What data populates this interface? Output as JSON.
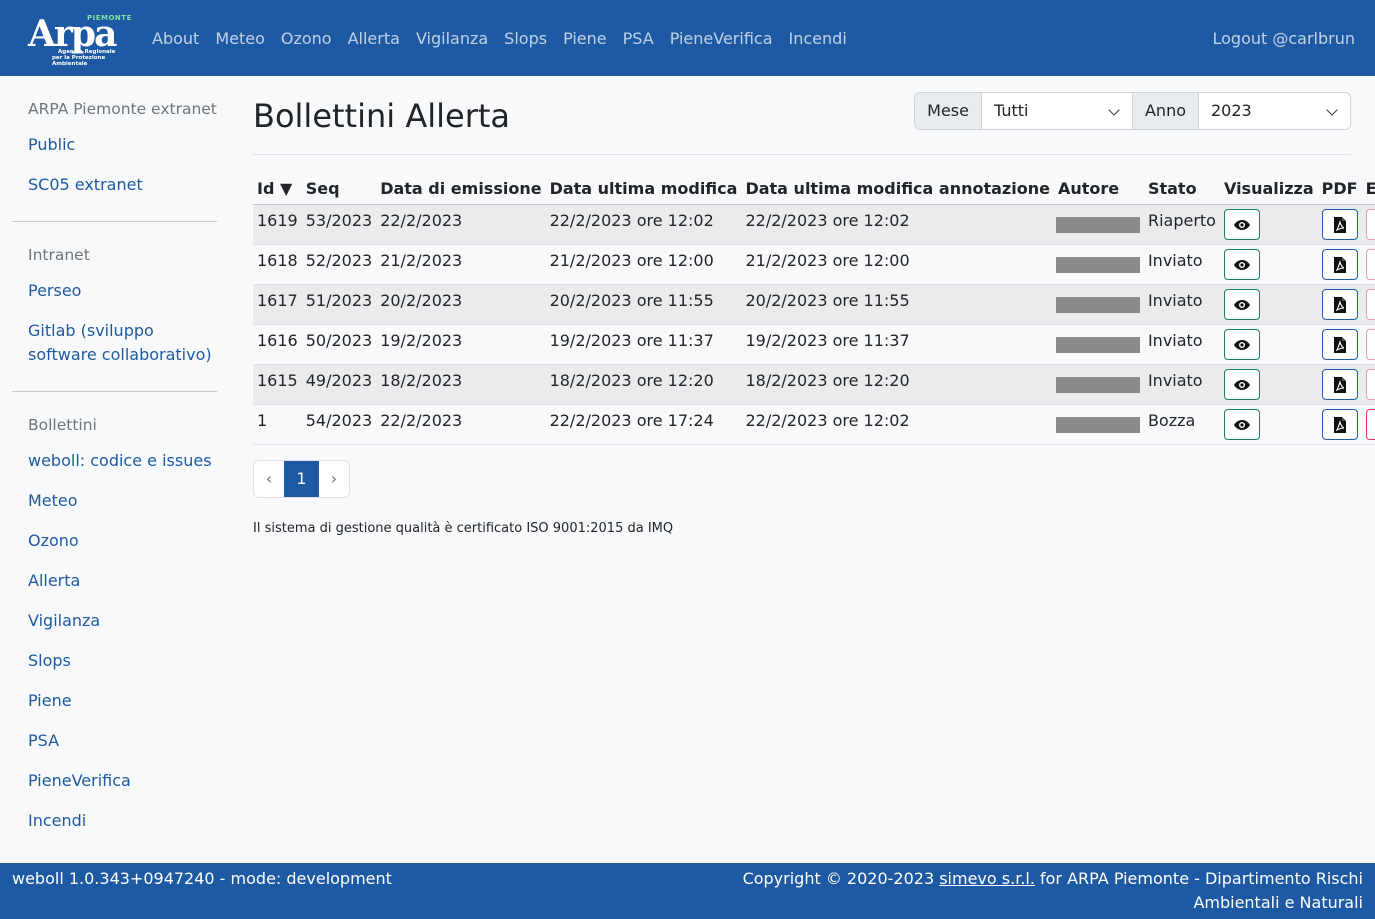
{
  "brand": {
    "word": "Arpa",
    "region": "PIEMONTE",
    "sub1": "Agenzia Regionale",
    "sub2": "per la Protezione Ambientale"
  },
  "nav": [
    "About",
    "Meteo",
    "Ozono",
    "Allerta",
    "Vigilanza",
    "Slops",
    "Piene",
    "PSA",
    "PieneVerifica",
    "Incendi"
  ],
  "logout": "Logout @carlbrun",
  "sidebar": {
    "groups": [
      {
        "title": "ARPA Piemonte extranet",
        "links": [
          "Public",
          "SC05 extranet"
        ]
      },
      {
        "title": "Intranet",
        "links": [
          "Perseo",
          "Gitlab (sviluppo software collaborativo)"
        ]
      },
      {
        "title": "Bollettini",
        "links": [
          "weboll: codice e issues",
          "Meteo",
          "Ozono",
          "Allerta",
          "Vigilanza",
          "Slops",
          "Piene",
          "PSA",
          "PieneVerifica",
          "Incendi"
        ]
      }
    ]
  },
  "page": {
    "title": "Bollettini Allerta"
  },
  "filters": {
    "mese_label": "Mese",
    "mese_value": "Tutti",
    "anno_label": "Anno",
    "anno_value": "2023"
  },
  "table": {
    "columns": [
      "Id ▼",
      "Seq",
      "Data di emissione",
      "Data ultima modifica",
      "Data ultima modifica annotazione",
      "Autore",
      "Stato",
      "Visualizza",
      "PDF",
      "Elimina"
    ],
    "rows": [
      {
        "id": "1619",
        "seq": "53/2023",
        "emissione": "22/2/2023",
        "modifica": "22/2/2023 ore 12:02",
        "annotazione": "22/2/2023 ore 12:02",
        "stato": "Riaperto",
        "delete_enabled": false
      },
      {
        "id": "1618",
        "seq": "52/2023",
        "emissione": "21/2/2023",
        "modifica": "21/2/2023 ore 12:00",
        "annotazione": "21/2/2023 ore 12:00",
        "stato": "Inviato",
        "delete_enabled": false
      },
      {
        "id": "1617",
        "seq": "51/2023",
        "emissione": "20/2/2023",
        "modifica": "20/2/2023 ore 11:55",
        "annotazione": "20/2/2023 ore 11:55",
        "stato": "Inviato",
        "delete_enabled": false
      },
      {
        "id": "1616",
        "seq": "50/2023",
        "emissione": "19/2/2023",
        "modifica": "19/2/2023 ore 11:37",
        "annotazione": "19/2/2023 ore 11:37",
        "stato": "Inviato",
        "delete_enabled": false
      },
      {
        "id": "1615",
        "seq": "49/2023",
        "emissione": "18/2/2023",
        "modifica": "18/2/2023 ore 12:20",
        "annotazione": "18/2/2023 ore 12:20",
        "stato": "Inviato",
        "delete_enabled": false
      },
      {
        "id": "1",
        "seq": "54/2023",
        "emissione": "22/2/2023",
        "modifica": "22/2/2023 ore 17:24",
        "annotazione": "22/2/2023 ore 12:02",
        "stato": "Bozza",
        "delete_enabled": true
      }
    ]
  },
  "pagination": {
    "prev": "‹",
    "current": "1",
    "next": "›"
  },
  "iso_note": "Il sistema di gestione qualità è certificato ISO 9001:2015 da IMQ",
  "footer": {
    "left": "weboll 1.0.343+0947240 - mode: development",
    "copyright_prefix": "Copyright © 2020-2023 ",
    "company": "simevo s.r.l.",
    "copyright_suffix": " for ARPA Piemonte - Dipartimento Rischi Ambientali e Naturali"
  },
  "colors": {
    "primary": "#1e5aa3",
    "success": "#198754",
    "danger": "#dc3545",
    "background": "#f8f9fa"
  },
  "icons": {
    "view": "eye-icon",
    "pdf": "file-pdf-icon",
    "delete": "trash-icon",
    "select": "chevron-down-icon"
  }
}
